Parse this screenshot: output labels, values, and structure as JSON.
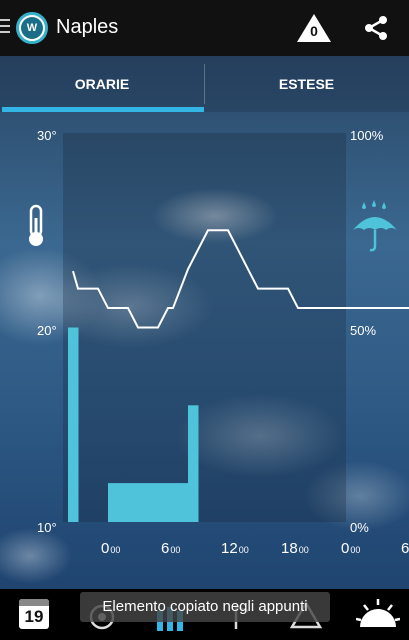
{
  "app": {
    "title": "Naples",
    "logo_text": "W",
    "alert_count": "0",
    "accent_color": "#33b5e5"
  },
  "tabs": [
    {
      "label": "ORARIE",
      "selected": true
    },
    {
      "label": "ESTESE",
      "selected": false
    }
  ],
  "chart_data": {
    "type": "line",
    "temp_axis": {
      "labels": [
        "30°",
        "20°",
        "10°"
      ],
      "ylim": [
        10,
        30
      ]
    },
    "precip_axis": {
      "labels": [
        "100%",
        "50%",
        "0%"
      ],
      "ylim": [
        0,
        100
      ]
    },
    "x_ticks": [
      {
        "hour": "0",
        "sub": "00"
      },
      {
        "hour": "6",
        "sub": "00"
      },
      {
        "hour": "12",
        "sub": "00"
      },
      {
        "hour": "18",
        "sub": "00"
      },
      {
        "hour": "0",
        "sub": "00"
      },
      {
        "hour": "6",
        "sub": "00"
      }
    ],
    "x_hours": [
      0,
      6,
      12,
      18,
      24,
      30
    ],
    "temperature": {
      "x": [
        -3.5,
        -3,
        -1,
        0,
        1,
        2,
        3,
        4,
        5,
        6,
        6.5,
        8,
        9,
        10,
        11,
        12,
        13,
        14,
        15,
        16,
        17,
        18,
        19,
        20,
        21,
        22,
        23,
        24,
        25,
        26,
        27,
        28,
        29,
        30,
        31
      ],
      "y": [
        22.9,
        22.0,
        22.0,
        21.0,
        21.0,
        21.0,
        20.0,
        20.0,
        20.0,
        21.0,
        21.0,
        23.0,
        24.0,
        25.0,
        25.0,
        25.0,
        24.0,
        23.0,
        22.0,
        22.0,
        22.0,
        22.0,
        21.0,
        21.0,
        21.0,
        21.0,
        21.0,
        21.0,
        21.0,
        21.0,
        21.0,
        21.0,
        21.0,
        21.0,
        21.0
      ]
    },
    "precipitation": [
      {
        "x_start": -4,
        "x_end": -3,
        "value": 50
      },
      {
        "x_start": 0,
        "x_end": 7,
        "value": 10
      },
      {
        "x_start": 7,
        "x_end": 8,
        "value": 10
      },
      {
        "x_start": 8,
        "x_end": 9,
        "value": 30
      }
    ],
    "temp_color": "#ffffff",
    "precip_color": "#4fc3d9"
  },
  "toast": {
    "text": "Elemento copiato negli appunti"
  },
  "bottom_nav": {
    "calendar_day": "19",
    "items": [
      "calendar-icon",
      "radar-icon",
      "chart-icon",
      "wind-icon",
      "alert-icon",
      "sun-icon"
    ]
  }
}
